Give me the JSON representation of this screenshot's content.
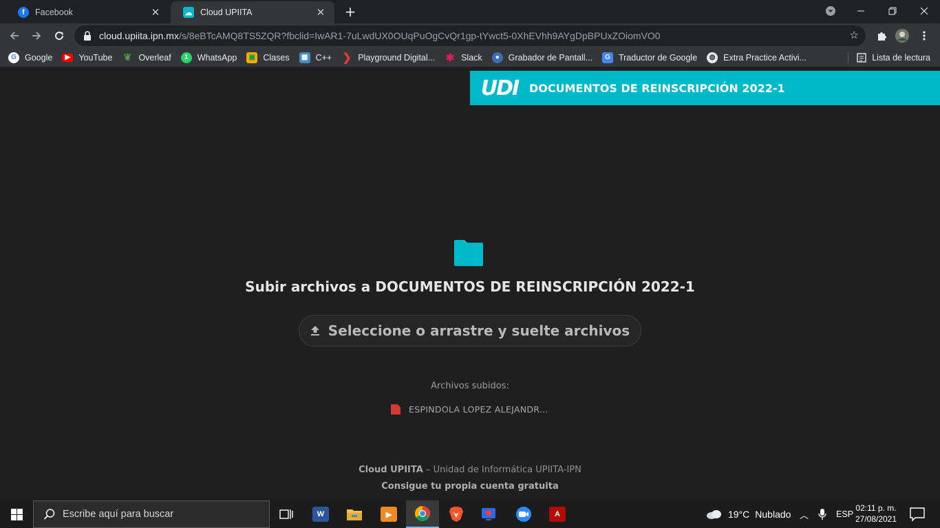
{
  "browser": {
    "tabs": [
      {
        "title": "Facebook",
        "icon": "facebook-icon",
        "active": false
      },
      {
        "title": "Cloud UPIITA",
        "icon": "cloud-icon",
        "active": true
      }
    ],
    "url_host": "cloud.upiita.ipn.mx",
    "url_path": "/s/8eBTcAMQ8TS5ZQR?fbclid=IwAR1-7uLwdUX0OUqPuOgCvQr1gp-tYwct5-0XhEVhh9AYgDpBPUxZOiomVO0",
    "bookmarks": [
      {
        "label": "Google",
        "icon": "google-icon",
        "color": "#ffffff"
      },
      {
        "label": "YouTube",
        "icon": "youtube-icon",
        "color": "#ff0000"
      },
      {
        "label": "Overleaf",
        "icon": "overleaf-icon",
        "color": "#4f9c45"
      },
      {
        "label": "WhatsApp",
        "icon": "whatsapp-icon",
        "color": "#25d366"
      },
      {
        "label": "Clases",
        "icon": "classroom-icon",
        "color": "#f9ab00"
      },
      {
        "label": "C++",
        "icon": "cpp-icon",
        "color": "#3e8fc7"
      },
      {
        "label": "Playground Digital...",
        "icon": "playground-icon",
        "color": "#e53935"
      },
      {
        "label": "Slack",
        "icon": "slack-icon",
        "color": "#e01e5a"
      },
      {
        "label": "Grabador de Pantall...",
        "icon": "screen-recorder-icon",
        "color": "#3d6fb6"
      },
      {
        "label": "Traductor de Google",
        "icon": "google-translate-icon",
        "color": "#4285f4"
      },
      {
        "label": "Extra Practice Activi...",
        "icon": "globe-icon",
        "color": "#e8eaed"
      }
    ],
    "reading_list": "Lista de lectura"
  },
  "page": {
    "header_title": "DOCUMENTOS DE REINSCRIPCIÓN 2022-1",
    "logo_text": "UDI",
    "upload_title_prefix": "Subir archivos a ",
    "upload_title_folder": "DOCUMENTOS DE REINSCRIPCIÓN 2022-1",
    "upload_button": "Seleccione o arrastre y suelte archivos",
    "uploaded_label": "Archivos subidos:",
    "uploaded_files": [
      "ESPINDOLA LOPEZ ALEJANDR..."
    ],
    "footer_brand": "Cloud UPIITA",
    "footer_sep": " – ",
    "footer_org": "Unidad de Informática UPIITA-IPN",
    "footer_link": "Consigue tu propia cuenta gratuita",
    "accent": "#00b9c9"
  },
  "taskbar": {
    "search_placeholder": "Escribe aquí para buscar",
    "apps": [
      {
        "name": "task-view-icon"
      },
      {
        "name": "word-icon",
        "color": "#2b579a"
      },
      {
        "name": "file-explorer-icon",
        "color": "#f6c342"
      },
      {
        "name": "slides-app-icon",
        "color": "#f08a24"
      },
      {
        "name": "chrome-icon",
        "active": true
      },
      {
        "name": "brave-icon",
        "color": "#fb542b"
      },
      {
        "name": "screen-recorder-app-icon",
        "color": "#2d6cdf"
      },
      {
        "name": "zoom-icon",
        "color": "#2d8cff"
      },
      {
        "name": "acrobat-icon",
        "color": "#b30b00"
      }
    ],
    "weather_temp": "19°C",
    "weather_text": "Nublado",
    "language": "ESP",
    "time": "02:11 p. m.",
    "date": "27/08/2021"
  }
}
